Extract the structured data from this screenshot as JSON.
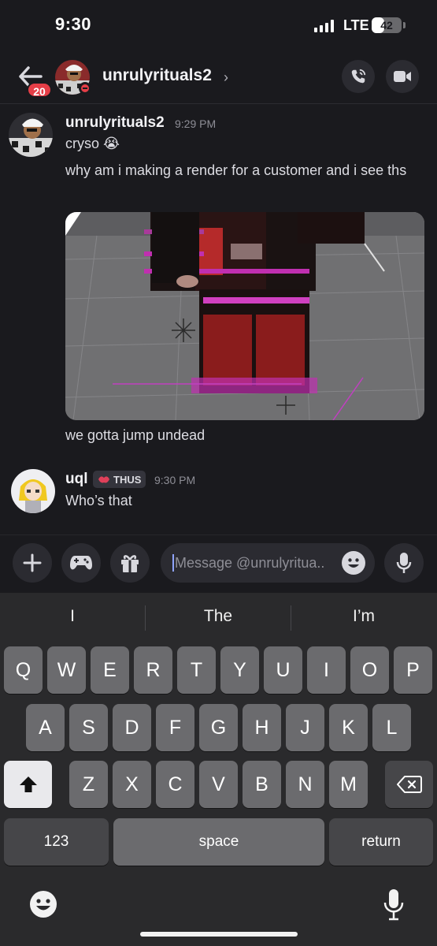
{
  "status_bar": {
    "time": "9:30",
    "network": "LTE",
    "battery": "42",
    "battery_level": 0.42
  },
  "header": {
    "unread_count": "20",
    "username": "unrulyrituals2",
    "chevron": "›",
    "call_icon": "phone-icon",
    "video_icon": "video-camera-icon"
  },
  "messages": [
    {
      "username": "unrulyrituals2",
      "timestamp": "9:29 PM",
      "lines": [
        "cryso 😭",
        "why am i making a render for a customer and i see ths",
        "we gotta jump undead"
      ],
      "attachment": "roblox-render-image"
    },
    {
      "username": "uql",
      "role_tag": "THUS",
      "role_icon": "lips-icon",
      "timestamp": "9:30 PM",
      "lines": [
        "Who’s that"
      ]
    }
  ],
  "composer": {
    "placeholder": "Message @unrulyritua..",
    "buttons": [
      "plus-icon",
      "gamepad-icon",
      "gift-icon"
    ]
  },
  "keyboard": {
    "suggestions": [
      "I",
      "The",
      "I’m"
    ],
    "row1": [
      "Q",
      "W",
      "E",
      "R",
      "T",
      "Y",
      "U",
      "I",
      "O",
      "P"
    ],
    "row2": [
      "A",
      "S",
      "D",
      "F",
      "G",
      "H",
      "J",
      "K",
      "L"
    ],
    "row3": [
      "Z",
      "X",
      "C",
      "V",
      "B",
      "N",
      "M"
    ],
    "numbers_label": "123",
    "space_label": "space",
    "return_label": "return"
  },
  "colors": {
    "background": "#1a1a1e",
    "badge_red": "#e53e47",
    "keyboard_bg": "#2a2a2c"
  }
}
